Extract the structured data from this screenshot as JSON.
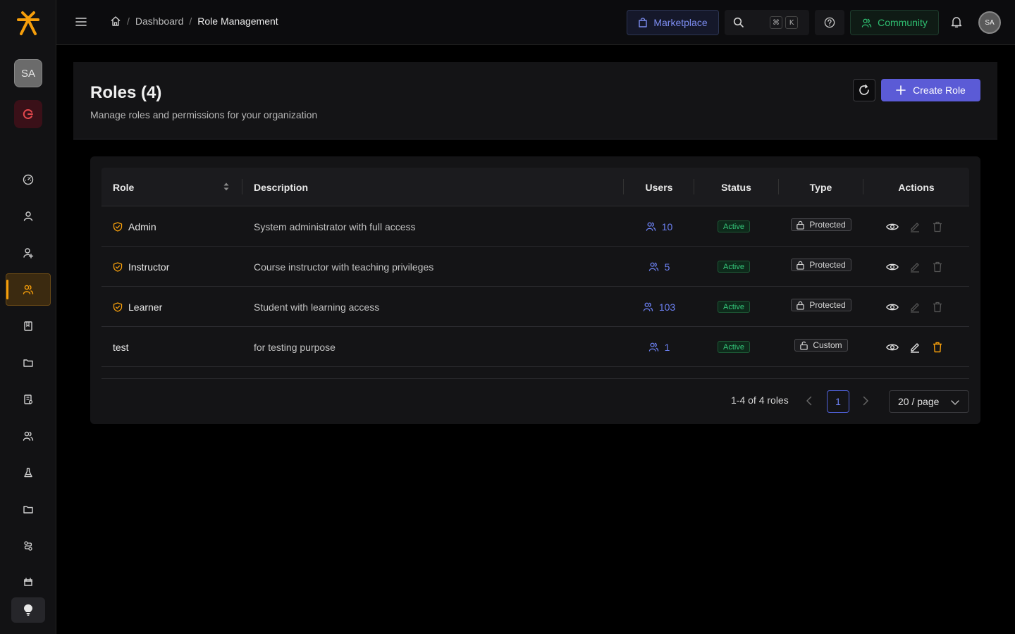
{
  "brand": {
    "accent": "#f59e0b",
    "primary": "#5b5bd6"
  },
  "sidebar": {
    "user_initials": "SA",
    "items": [
      {
        "icon": "dashboard-icon"
      },
      {
        "icon": "user-icon"
      },
      {
        "icon": "user-add-icon"
      },
      {
        "icon": "users-icon",
        "active": true
      },
      {
        "icon": "book-icon"
      },
      {
        "icon": "folder-icon"
      },
      {
        "icon": "report-icon"
      },
      {
        "icon": "team-icon"
      },
      {
        "icon": "flask-icon"
      },
      {
        "icon": "folder-icon"
      },
      {
        "icon": "workflow-icon"
      },
      {
        "icon": "calendar-icon"
      }
    ]
  },
  "topbar": {
    "breadcrumb": [
      "Dashboard",
      "Role Management"
    ],
    "marketplace_label": "Marketplace",
    "shortcut_keys": [
      "⌘",
      "K"
    ],
    "community_label": "Community",
    "avatar_initials": "SA"
  },
  "header": {
    "title": "Roles (4)",
    "subtitle": "Manage roles and permissions for your organization",
    "create_label": "Create Role"
  },
  "table": {
    "columns": [
      "Role",
      "Description",
      "Users",
      "Status",
      "Type",
      "Actions"
    ],
    "rows": [
      {
        "name": "Admin",
        "description": "System administrator with full access",
        "users": "10",
        "status": "Active",
        "type": "Protected"
      },
      {
        "name": "Instructor",
        "description": "Course instructor with teaching privileges",
        "users": "5",
        "status": "Active",
        "type": "Protected"
      },
      {
        "name": "Learner",
        "description": "Student with learning access",
        "users": "103",
        "status": "Active",
        "type": "Protected"
      },
      {
        "name": "test",
        "description": "for testing purpose",
        "users": "1",
        "status": "Active",
        "type": "Custom"
      }
    ]
  },
  "pagination": {
    "range": "1-4 of 4 roles",
    "current_page": "1",
    "page_size": "20 / page"
  }
}
